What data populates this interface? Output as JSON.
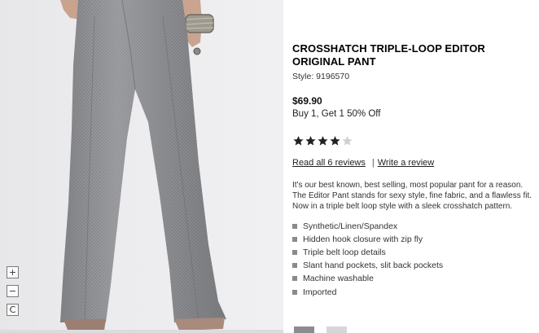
{
  "product": {
    "title": "CROSSHATCH TRIPLE-LOOP EDITOR ORIGINAL PANT",
    "style": "Style: 9196570",
    "price": "$69.90",
    "promo": "Buy 1, Get 1 50% Off",
    "rating": {
      "value": 4,
      "max": 5,
      "filled_color": "#222222",
      "empty_color": "#d0d0d0"
    },
    "reviews_link": "Read all 6 reviews",
    "review_separator": "|",
    "write_review_link": "Write a review",
    "description": "It's our best known, best selling, most popular pant for a reason. The Editor Pant stands for sexy style, fine fabric, and a flawless fit. Now in a triple belt loop style with a sleek crosshatch pattern.",
    "features": [
      "Synthetic/Linen/Spandex",
      "Hidden hook closure with zip fly",
      "Triple belt loop details",
      "Slant hand pockets, slit back pockets",
      "Machine washable",
      "Imported"
    ]
  },
  "zoom": {
    "zoom_in_icon": "plus-icon",
    "zoom_out_icon": "minus-icon",
    "reset_icon": "reset-icon",
    "zoom_in_label": "+",
    "zoom_out_label": "−",
    "reset_label": "C"
  },
  "image": {
    "description_icon": "product-photo",
    "pant_color": "#8e8f93",
    "background": "#ececee"
  },
  "thumbnails": [
    {
      "name": "thumb-gray"
    },
    {
      "name": "thumb-light"
    }
  ]
}
